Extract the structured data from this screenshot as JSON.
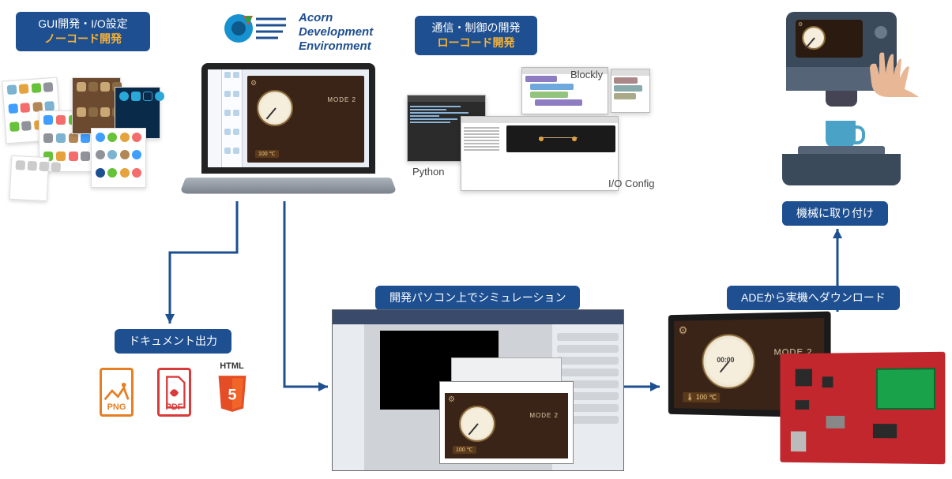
{
  "brand": {
    "line1": "Acorn",
    "line2": "Development",
    "line3": "Environment"
  },
  "pills": {
    "gui": {
      "title": "GUI開発・I/O設定",
      "sub": "ノーコード開発"
    },
    "comm": {
      "title": "通信・制御の開発",
      "sub": "ローコード開発"
    },
    "doc": {
      "title": "ドキュメント出力"
    },
    "sim": {
      "title": "開発パソコン上でシミュレーション"
    },
    "dl": {
      "title": "ADEから実機へダウンロード"
    },
    "mount": {
      "title": "機械に取り付け"
    }
  },
  "labels": {
    "python": "Python",
    "blockly": "Blockly",
    "ioconfig": "I/O Config"
  },
  "gui_preview": {
    "mode": "MODE 2",
    "temp": "100 ℃",
    "gauge_center": "00:00"
  },
  "docs": {
    "png": "PNG",
    "pdf": "PDF",
    "html": "HTML",
    "html_badge": "5"
  },
  "colors": {
    "brand": "#1d4f91",
    "accent": "#f9b233",
    "pcb": "#c1272d",
    "html5": "#e44d26",
    "pdf": "#d93a3a",
    "png": "#e67e22"
  }
}
